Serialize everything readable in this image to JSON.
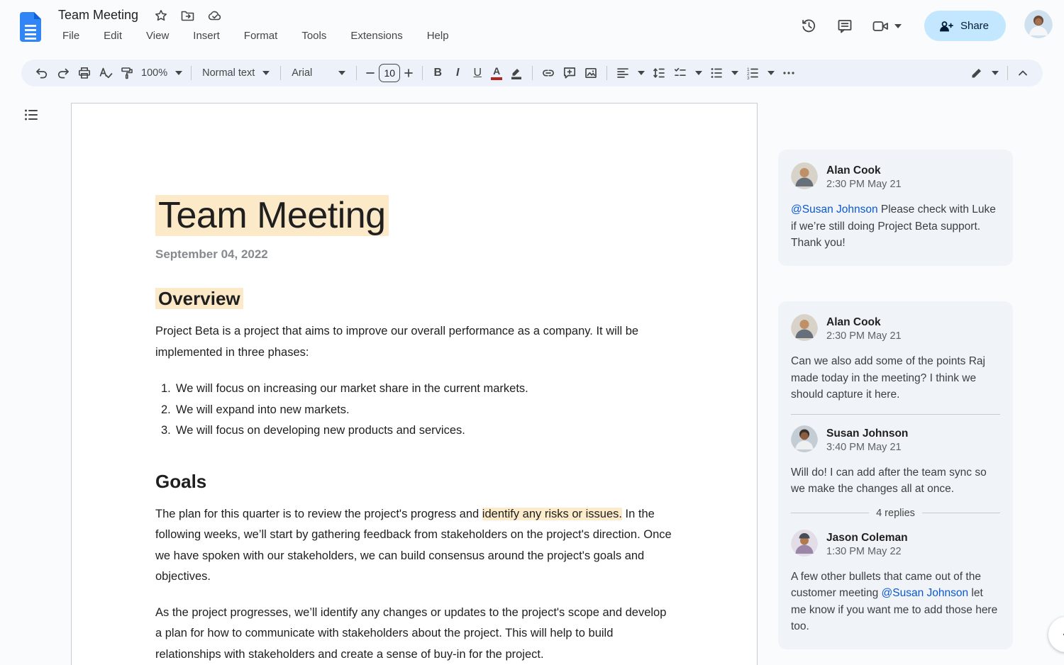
{
  "header": {
    "doc_title": "Team Meeting",
    "menu_items": [
      "File",
      "Edit",
      "View",
      "Insert",
      "Format",
      "Tools",
      "Extensions",
      "Help"
    ],
    "share_label": "Share"
  },
  "toolbar": {
    "zoom_level": "100%",
    "paragraph_style": "Normal text",
    "font_family": "Arial",
    "font_size": "10",
    "bold_glyph": "B",
    "italic_glyph": "I",
    "underline_glyph": "U",
    "text_color_glyph": "A"
  },
  "document": {
    "title": "Team Meeting",
    "date": "September 04, 2022",
    "overview": {
      "heading": "Overview",
      "intro": "Project Beta is a project that aims to improve our overall performance as a company. It will be implemented in three phases:",
      "list_items": [
        {
          "marker": "1.",
          "text": "We will focus on increasing our market share in the current markets."
        },
        {
          "marker": "2.",
          "text": "We will expand into new markets."
        },
        {
          "marker": "3.",
          "text": "We will focus on developing new products and services."
        }
      ]
    },
    "goals": {
      "heading": "Goals",
      "p1_pre": "The plan for this quarter is to review the project's progress and ",
      "p1_highlight": "identify any risks or issues.",
      "p1_post": " In the following weeks, we’ll start by gathering feedback from stakeholders on the project's direction. Once we have spoken with our stakeholders, we can build consensus around the project's goals and objectives.",
      "p2": "As the project progresses, we’ll identify any changes or updates to the project's scope and develop a plan for how to communicate with stakeholders about the project. This will help to build relationships with stakeholders and create a sense of buy-in for the project."
    }
  },
  "comments": {
    "thread1": {
      "author": "Alan Cook",
      "timestamp": "2:30 PM May 21",
      "mention": "@Susan Johnson",
      "body_after_mention": " Please check with Luke if we’re still doing Project Beta support. Thank you!"
    },
    "thread2": {
      "comment1": {
        "author": "Alan Cook",
        "timestamp": "2:30 PM May 21",
        "body": "Can we also add some of the points Raj made today in the meeting? I think we should capture it here."
      },
      "comment2": {
        "author": "Susan Johnson",
        "timestamp": "3:40 PM May 21",
        "body": "Will do! I can add after the team sync so we make the changes all at once."
      },
      "replies_label": "4 replies",
      "comment3": {
        "author": "Jason Coleman",
        "timestamp": "1:30 PM May 22",
        "body_pre": "A few other bullets that came out of the customer meeting ",
        "mention": "@Susan Johnson",
        "body_post": " let me know if you want me to add those here too."
      }
    }
  },
  "colors": {
    "highlight": "#fce9c8",
    "mention_blue": "#0b57d0",
    "share_button_bg": "#c2e7ff",
    "toolbar_bg": "#edf2fa",
    "comment_card_bg": "#f0f4f9"
  }
}
